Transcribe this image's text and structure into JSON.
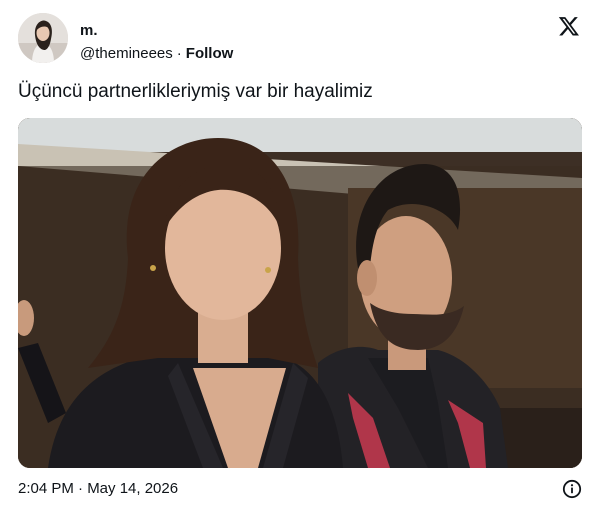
{
  "author": {
    "display_name": "m.",
    "handle": "@themineees",
    "separator": "·",
    "follow_label": "Follow"
  },
  "tweet": {
    "text": "Üçüncü partnerlikleriymiş var bir hayalimiz",
    "media_kind": "photo"
  },
  "footer": {
    "timestamp": "2:04 PM · May 14, 2026"
  },
  "icons": {
    "brand": "x-logo-icon",
    "info": "info-icon"
  },
  "colors": {
    "text": "#0f1419",
    "background": "#ffffff"
  }
}
